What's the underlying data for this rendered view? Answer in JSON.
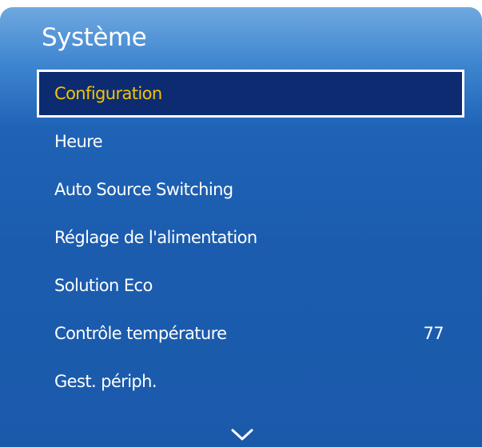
{
  "menu": {
    "title": "Système",
    "items": [
      {
        "label": "Configuration",
        "value": "",
        "selected": true
      },
      {
        "label": "Heure",
        "value": ""
      },
      {
        "label": "Auto Source Switching",
        "value": ""
      },
      {
        "label": "Réglage de l'alimentation",
        "value": ""
      },
      {
        "label": "Solution Eco",
        "value": ""
      },
      {
        "label": "Contrôle température",
        "value": "77"
      },
      {
        "label": "Gest. périph.",
        "value": ""
      }
    ],
    "scroll_icon": "chevron-down-icon"
  },
  "colors": {
    "panel_top": "#6fa8df",
    "panel_bottom": "#1b5aab",
    "selected_background": "#0c2b70",
    "selected_text": "#f5c400",
    "text": "#ffffff"
  }
}
